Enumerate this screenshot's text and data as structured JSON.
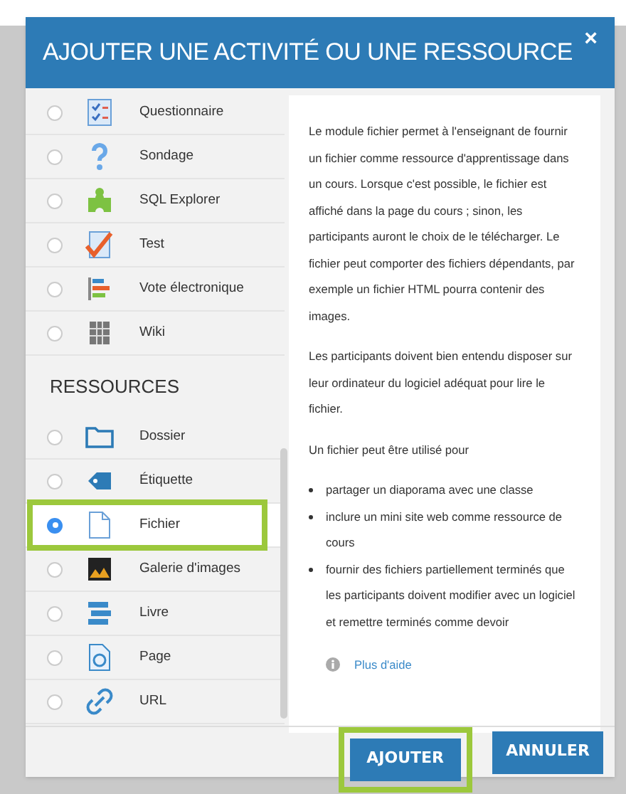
{
  "dialog": {
    "title": "AJOUTER UNE ACTIVITÉ OU UNE RESSOURCE",
    "close": "×"
  },
  "activities": [
    {
      "label": "Questionnaire",
      "selected": false
    },
    {
      "label": "Sondage",
      "selected": false
    },
    {
      "label": "SQL Explorer",
      "selected": false
    },
    {
      "label": "Test",
      "selected": false
    },
    {
      "label": "Vote électronique",
      "selected": false
    },
    {
      "label": "Wiki",
      "selected": false
    }
  ],
  "resources_heading": "RESSOURCES",
  "resources": [
    {
      "label": "Dossier",
      "selected": false,
      "highlighted": false
    },
    {
      "label": "Étiquette",
      "selected": false,
      "highlighted": false
    },
    {
      "label": "Fichier",
      "selected": true,
      "highlighted": true
    },
    {
      "label": "Galerie d'images",
      "selected": false,
      "highlighted": false
    },
    {
      "label": "Livre",
      "selected": false,
      "highlighted": false
    },
    {
      "label": "Page",
      "selected": false,
      "highlighted": false
    },
    {
      "label": "URL",
      "selected": false,
      "highlighted": false
    }
  ],
  "description": {
    "paragraphs": [
      "Le module fichier permet à l'enseignant de fournir un fichier comme ressource d'apprentissage dans un cours. Lorsque c'est possible, le fichier est affiché dans la page du cours ; sinon, les participants auront le choix de le télécharger. Le fichier peut comporter des fichiers dépendants, par exemple un fichier HTML pourra contenir des images.",
      "Les participants doivent bien entendu disposer sur leur ordinateur du logiciel adéquat pour lire le fichier.",
      "Un fichier peut être utilisé pour"
    ],
    "bullets": [
      "partager un diaporama avec une classe",
      "inclure un mini site web comme ressource de cours",
      "fournir des fichiers partiellement terminés que les participants doivent modifier avec un logiciel et remettre terminés comme devoir"
    ],
    "help_link": "Plus d'aide"
  },
  "buttons": [
    {
      "label": "AJOUTER",
      "highlighted": true
    },
    {
      "label": "ANNULER",
      "highlighted": false
    }
  ]
}
